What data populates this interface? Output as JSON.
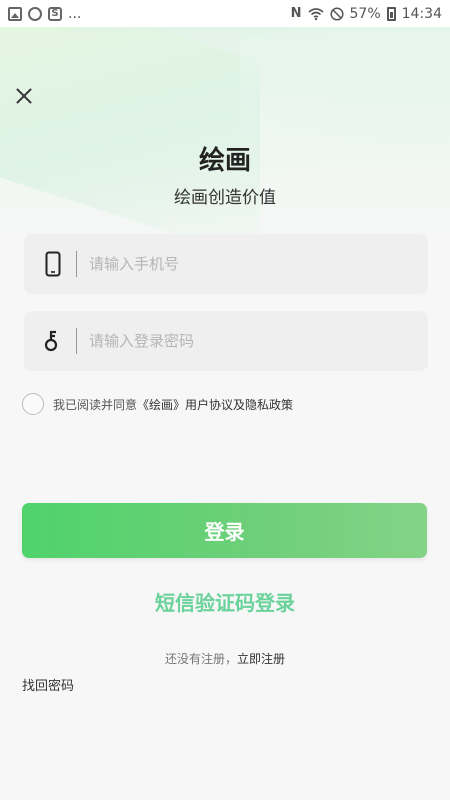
{
  "status_bar": {
    "dots": "...",
    "battery_percent": "57%",
    "time": "14:34"
  },
  "app": {
    "title": "绘画",
    "subtitle": "绘画创造价值"
  },
  "form": {
    "phone_placeholder": "请输入手机号",
    "password_placeholder": "请输入登录密码"
  },
  "agreement": {
    "prefix": "我已阅读并同意",
    "policy": "《绘画》用户协议及隐私政策"
  },
  "actions": {
    "login_label": "登录",
    "sms_login_label": "短信验证码登录",
    "register_prompt": "还没有注册，",
    "register_link": "立即注册",
    "forgot_password": "找回密码"
  },
  "colors": {
    "primary_green": "#4fd36a",
    "sms_link_green": "#6ad29a"
  }
}
